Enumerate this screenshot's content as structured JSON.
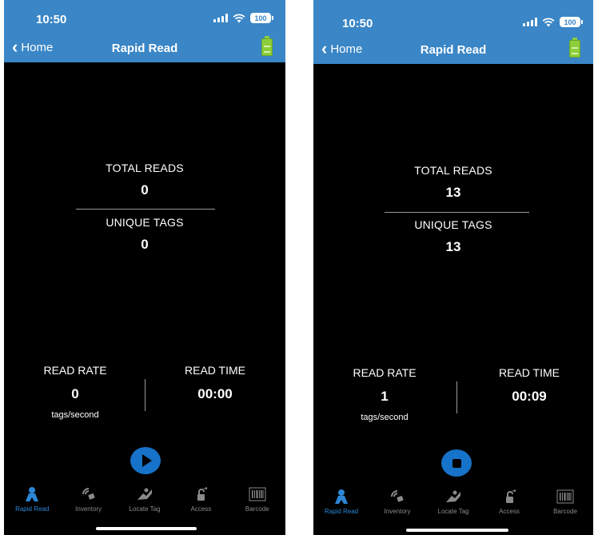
{
  "screens": [
    {
      "status": {
        "time": "10:50",
        "battery": "100"
      },
      "nav": {
        "back_label": "Home",
        "title": "Rapid Read"
      },
      "stats": {
        "total_reads_label": "TOTAL READS",
        "total_reads_value": "0",
        "unique_tags_label": "UNIQUE TAGS",
        "unique_tags_value": "0"
      },
      "rate": {
        "read_rate_label": "READ RATE",
        "read_rate_value": "0",
        "read_rate_unit": "tags/second",
        "read_time_label": "READ TIME",
        "read_time_value": "00:00"
      },
      "action": "play",
      "tabs": [
        {
          "label": "Rapid Read",
          "icon": "rapid-read-icon",
          "active": true
        },
        {
          "label": "Inventory",
          "icon": "inventory-icon",
          "active": false
        },
        {
          "label": "Locate Tag",
          "icon": "locate-tag-icon",
          "active": false
        },
        {
          "label": "Access",
          "icon": "access-icon",
          "active": false
        },
        {
          "label": "Barcode",
          "icon": "barcode-icon",
          "active": false
        }
      ]
    },
    {
      "status": {
        "time": "10:50",
        "battery": "100"
      },
      "nav": {
        "back_label": "Home",
        "title": "Rapid Read"
      },
      "stats": {
        "total_reads_label": "TOTAL READS",
        "total_reads_value": "13",
        "unique_tags_label": "UNIQUE TAGS",
        "unique_tags_value": "13"
      },
      "rate": {
        "read_rate_label": "READ RATE",
        "read_rate_value": "1",
        "read_rate_unit": "tags/second",
        "read_time_label": "READ TIME",
        "read_time_value": "00:09"
      },
      "action": "stop",
      "tabs": [
        {
          "label": "Rapid Read",
          "icon": "rapid-read-icon",
          "active": true
        },
        {
          "label": "Inventory",
          "icon": "inventory-icon",
          "active": false
        },
        {
          "label": "Locate Tag",
          "icon": "locate-tag-icon",
          "active": false
        },
        {
          "label": "Access",
          "icon": "access-icon",
          "active": false
        },
        {
          "label": "Barcode",
          "icon": "barcode-icon",
          "active": false
        }
      ]
    }
  ],
  "colors": {
    "accent": "#3a86c6",
    "active_tab": "#2d86d6",
    "button": "#1673c9",
    "reader_battery": "#8ccf3a"
  }
}
